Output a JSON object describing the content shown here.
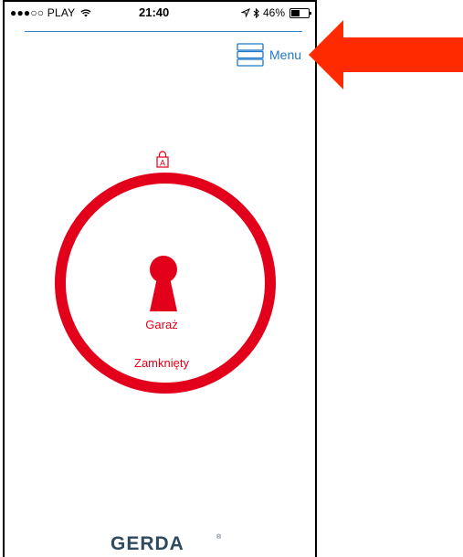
{
  "status_bar": {
    "carrier": "●●●○○ PLAY",
    "time": "21:40",
    "battery": "46%"
  },
  "header": {
    "menu_label": "Menu"
  },
  "door": {
    "name": "Garaż",
    "status": "Zamknięty",
    "lock_mode_letter": "A"
  },
  "brand": {
    "logo_text": "GERDA"
  },
  "colors": {
    "accent_red": "#e2001a",
    "accent_blue": "#1f78c8",
    "annotation_arrow": "#ff2a00"
  },
  "icons": {
    "menu": "menu-icon",
    "lock": "lock-icon",
    "keyhole": "keyhole-icon",
    "wifi": "wifi-icon",
    "location": "location-icon",
    "bluetooth": "bluetooth-icon",
    "battery": "battery-icon"
  }
}
